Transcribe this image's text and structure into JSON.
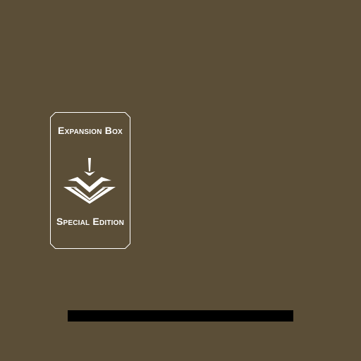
{
  "screen": {
    "background_color": "#5b4e37"
  },
  "edition_card": {
    "title": "Expansion Box",
    "subtitle": "Special Edition",
    "emblem_icon": "book-emblem-icon",
    "text_color": "#ffffff",
    "border_color": "#ffffff"
  },
  "loading_bar": {
    "progress": 0,
    "track_color": "#000000",
    "fill_color": "#ffffff"
  }
}
